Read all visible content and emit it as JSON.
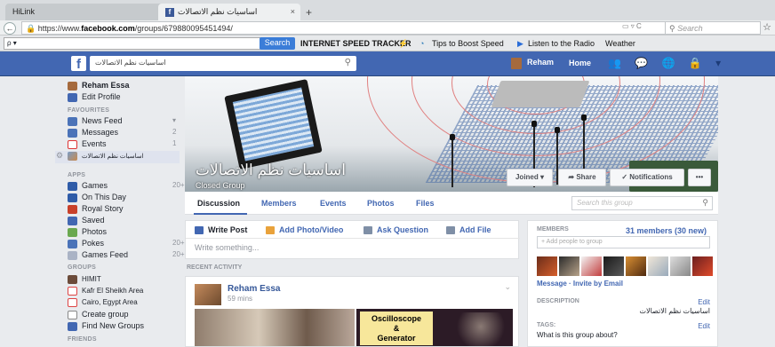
{
  "browser": {
    "tab1_label": "HiLink",
    "tab2_label": "اساسيات نظم الاتصالات",
    "tab_close": "×",
    "new_tab": "+",
    "url_prefix": "https://www.",
    "url_domain": "facebook.com",
    "url_path": "/groups/679880095451494/",
    "url_icons": "▭ ▿ C",
    "search_placeholder": "Search",
    "star": "☆",
    "nav_back": "←"
  },
  "toolbar": {
    "search_field": "ρ ▾",
    "search_button": "Search",
    "speed_tracker": "INTERNET SPEED TRACKER",
    "tips": "Tips to Boost Speed",
    "radio": "Listen to the Radio",
    "weather": "Weather"
  },
  "fb": {
    "search_value": "اساسيات نظم الاتصالات",
    "user_name": "Reham",
    "home": "Home",
    "icons": "👥 💬 🌐 🔒 ▾"
  },
  "leftnav": {
    "profile_name": "Reham Essa",
    "edit_profile": "Edit Profile",
    "favourites_head": "FAVOURITES",
    "favourites": [
      {
        "label": "News Feed",
        "count": "▾"
      },
      {
        "label": "Messages",
        "count": "2"
      },
      {
        "label": "Events",
        "count": "1"
      },
      {
        "label": "اساسيات نظم الاتصالات",
        "count": ""
      }
    ],
    "apps_head": "APPS",
    "apps": [
      {
        "label": "Games",
        "count": "20+"
      },
      {
        "label": "On This Day",
        "count": ""
      },
      {
        "label": "Royal Story",
        "count": ""
      },
      {
        "label": "Saved",
        "count": ""
      },
      {
        "label": "Photos",
        "count": ""
      },
      {
        "label": "Pokes",
        "count": "20+"
      },
      {
        "label": "Games Feed",
        "count": "20+"
      }
    ],
    "groups_head": "GROUPS",
    "groups": [
      {
        "label": "HIMIT"
      },
      {
        "label": "Kafr El Sheikh Area"
      },
      {
        "label": "Cairo, Egypt Area"
      },
      {
        "label": "Create group"
      },
      {
        "label": "Find New Groups"
      }
    ],
    "friends_head": "FRIENDS"
  },
  "cover": {
    "title": "اساسيات نظم الاتصالات",
    "subtitle": "Closed Group",
    "joined": "Joined ▾",
    "share": "➦ Share",
    "notifications": "✓ Notifications",
    "more": "•••"
  },
  "tabs": {
    "items": [
      "Discussion",
      "Members",
      "Events",
      "Photos",
      "Files"
    ],
    "search_placeholder": "Search this group"
  },
  "composer": {
    "write_post": "Write Post",
    "add_photo": "Add Photo/Video",
    "ask_question": "Ask Question",
    "add_file": "Add File",
    "placeholder": "Write something..."
  },
  "feed": {
    "recent_activity": "RECENT ACTIVITY",
    "post_author": "Reham Essa",
    "post_time": "59 mins",
    "image_text_1": "Oscilloscope",
    "image_text_2": "&",
    "image_text_3": "Generator"
  },
  "right": {
    "members_head": "MEMBERS",
    "members_count": "31 members (30 new)",
    "add_people": "+ Add people to group",
    "message_invite": "Message · Invite by Email",
    "description_head": "DESCRIPTION",
    "description_edit": "Edit",
    "description_text": "اساسيات نظم الاتصالات",
    "tags_head": "TAGS:",
    "tags_edit": "Edit",
    "tags_text": "What is this group about?"
  }
}
